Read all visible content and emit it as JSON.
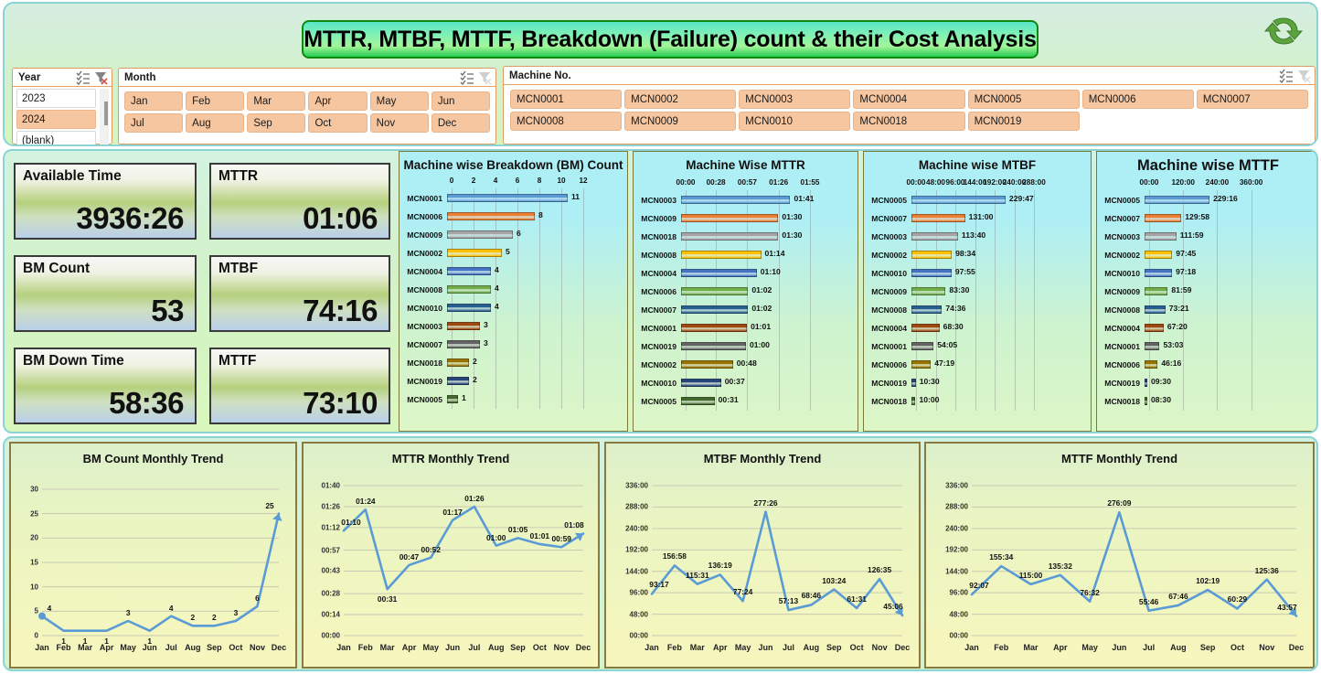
{
  "header": {
    "title": "MTTR, MTBF, MTTF, Breakdown (Failure) count & their Cost Analysis",
    "refresh_icon": "refresh-sync-icon"
  },
  "slicers": {
    "year": {
      "title": "Year",
      "multi_select_icon": "multi-select-icon",
      "clear_filter_icon": "clear-filter-icon",
      "items": [
        {
          "label": "2023",
          "selected": false
        },
        {
          "label": "2024",
          "selected": true
        },
        {
          "label": "(blank)",
          "selected": false
        }
      ]
    },
    "month": {
      "title": "Month",
      "multi_select_icon": "multi-select-icon",
      "clear_filter_icon": "clear-filter-icon",
      "items": [
        "Jan",
        "Feb",
        "Mar",
        "Apr",
        "May",
        "Jun",
        "Jul",
        "Aug",
        "Sep",
        "Oct",
        "Nov",
        "Dec"
      ]
    },
    "machine": {
      "title": "Machine No.",
      "multi_select_icon": "multi-select-icon",
      "clear_filter_icon": "clear-filter-icon",
      "items": [
        "MCN0001",
        "MCN0002",
        "MCN0003",
        "MCN0004",
        "MCN0005",
        "MCN0006",
        "MCN0007",
        "MCN0008",
        "MCN0009",
        "MCN0010",
        "MCN0018",
        "MCN0019"
      ]
    }
  },
  "kpis": [
    {
      "label": "Available Time",
      "value": "3936:26"
    },
    {
      "label": "MTTR",
      "value": "01:06"
    },
    {
      "label": "BM Count",
      "value": "53"
    },
    {
      "label": "MTBF",
      "value": "74:16"
    },
    {
      "label": "BM Down Time",
      "value": "58:36"
    },
    {
      "label": "MTTF",
      "value": "73:10"
    }
  ],
  "palette": {
    "series": [
      "#5b9bd5",
      "#ed7d31",
      "#a5a5a5",
      "#ffc000",
      "#4472c4",
      "#70ad47",
      "#255e91",
      "#9e480e",
      "#636363",
      "#997300",
      "#264478",
      "#43682b"
    ],
    "accent_green": "#27cc52",
    "panel_border": "#8ad4d4",
    "chip": "#f5c6a0"
  },
  "chart_data": [
    {
      "type": "bar",
      "id": "machine-wise-bm-count",
      "title": "Machine wise Breakdown (BM) Count",
      "orientation": "horizontal",
      "categories": [
        "MCN0001",
        "MCN0006",
        "MCN0009",
        "MCN0002",
        "MCN0004",
        "MCN0008",
        "MCN0010",
        "MCN0003",
        "MCN0007",
        "MCN0018",
        "MCN0019",
        "MCN0005"
      ],
      "values": [
        11,
        8,
        6,
        5,
        4,
        4,
        4,
        3,
        3,
        2,
        2,
        1
      ],
      "labels": [
        "11",
        "8",
        "6",
        "5",
        "4",
        "4",
        "4",
        "3",
        "3",
        "2",
        "2",
        "1"
      ],
      "ticks": [
        "0",
        "2",
        "4",
        "6",
        "8",
        "10",
        "12"
      ],
      "tick_values": [
        0,
        2,
        4,
        6,
        8,
        10,
        12
      ],
      "xlim": [
        0,
        12
      ],
      "xlabel": "",
      "ylabel": "",
      "grid": true,
      "legend": "none"
    },
    {
      "type": "bar",
      "id": "machine-wise-mttr",
      "title": "Machine Wise MTTR",
      "orientation": "horizontal",
      "categories": [
        "MCN0003",
        "MCN0009",
        "MCN0018",
        "MCN0008",
        "MCN0004",
        "MCN0006",
        "MCN0007",
        "MCN0001",
        "MCN0019",
        "MCN0002",
        "MCN0010",
        "MCN0005"
      ],
      "labels": [
        "01:41",
        "01:30",
        "01:30",
        "01:14",
        "01:10",
        "01:02",
        "01:02",
        "01:01",
        "01:00",
        "00:48",
        "00:37",
        "00:31"
      ],
      "values": [
        101,
        90,
        90,
        74,
        70,
        62,
        62,
        61,
        60,
        48,
        37,
        31
      ],
      "value_unit": "minutes",
      "ticks": [
        "00:00",
        "00:28",
        "00:57",
        "01:26",
        "01:55"
      ],
      "tick_values": [
        0,
        28,
        57,
        86,
        115
      ],
      "xlim": [
        0,
        115
      ],
      "xlabel": "",
      "ylabel": "",
      "grid": true,
      "legend": "none"
    },
    {
      "type": "bar",
      "id": "machine-wise-mtbf",
      "title": "Machine wise MTBF",
      "orientation": "horizontal",
      "categories": [
        "MCN0005",
        "MCN0007",
        "MCN0003",
        "MCN0002",
        "MCN0010",
        "MCN0009",
        "MCN0008",
        "MCN0004",
        "MCN0001",
        "MCN0006",
        "MCN0019",
        "MCN0018"
      ],
      "labels": [
        "229:47",
        "131:00",
        "113:40",
        "98:34",
        "97:55",
        "83:30",
        "74:36",
        "68:30",
        "54:05",
        "47:19",
        "10:30",
        "10:00"
      ],
      "values": [
        229.78,
        131.0,
        113.67,
        98.57,
        97.92,
        83.5,
        74.6,
        68.5,
        54.08,
        47.32,
        10.5,
        10.0
      ],
      "value_unit": "hours",
      "ticks": [
        "00:00",
        "48:00",
        "96:00",
        "144:00",
        "192:00",
        "240:00",
        "288:00"
      ],
      "tick_values": [
        0,
        48,
        96,
        144,
        192,
        240,
        288
      ],
      "xlim": [
        0,
        288
      ],
      "xlabel": "",
      "ylabel": "",
      "grid": true,
      "legend": "none"
    },
    {
      "type": "bar",
      "id": "machine-wise-mttf",
      "title": "Machine wise MTTF",
      "orientation": "horizontal",
      "categories": [
        "MCN0005",
        "MCN0007",
        "MCN0003",
        "MCN0002",
        "MCN0010",
        "MCN0009",
        "MCN0008",
        "MCN0004",
        "MCN0001",
        "MCN0006",
        "MCN0019",
        "MCN0018"
      ],
      "labels": [
        "229:16",
        "129:58",
        "111:59",
        "97:45",
        "97:18",
        "81:59",
        "73:21",
        "67:20",
        "53:03",
        "46:16",
        "09:30",
        "08:30"
      ],
      "values": [
        229.27,
        129.97,
        111.98,
        97.75,
        97.3,
        81.98,
        73.35,
        67.33,
        53.05,
        46.27,
        9.5,
        8.5
      ],
      "value_unit": "hours",
      "ticks": [
        "00:00",
        "120:00",
        "240:00",
        "360:00"
      ],
      "tick_values": [
        0,
        120,
        240,
        360
      ],
      "xlim": [
        0,
        400
      ],
      "xlabel": "",
      "ylabel": "",
      "grid": true,
      "legend": "none"
    },
    {
      "type": "line",
      "id": "bm-count-monthly-trend",
      "title": "BM Count Monthly Trend",
      "categories": [
        "Jan",
        "Feb",
        "Mar",
        "Apr",
        "May",
        "Jun",
        "Jul",
        "Aug",
        "Sep",
        "Oct",
        "Nov",
        "Dec"
      ],
      "values": [
        4,
        1,
        1,
        1,
        3,
        1,
        4,
        2,
        2,
        3,
        6,
        25
      ],
      "labels": [
        "4",
        "1",
        "1",
        "1",
        "3",
        "1",
        "4",
        "2",
        "2",
        "3",
        "6",
        "25"
      ],
      "yticks": [
        "0",
        "5",
        "10",
        "15",
        "20",
        "25",
        "30"
      ],
      "ytick_values": [
        0,
        5,
        10,
        15,
        20,
        25,
        30
      ],
      "ylim": [
        0,
        30
      ],
      "xlabel": "",
      "ylabel": "",
      "grid": true,
      "legend": "none",
      "line_color": "#5b9bd5"
    },
    {
      "type": "line",
      "id": "mttr-monthly-trend",
      "title": "MTTR Monthly Trend",
      "categories": [
        "Jan",
        "Feb",
        "Mar",
        "Apr",
        "May",
        "Jun",
        "Jul",
        "Aug",
        "Sep",
        "Oct",
        "Nov",
        "Dec"
      ],
      "labels": [
        "01:10",
        "01:24",
        "00:31",
        "00:47",
        "00:52",
        "01:17",
        "01:26",
        "01:00",
        "01:05",
        "01:01",
        "00:59",
        "01:08"
      ],
      "values": [
        70,
        84,
        31,
        47,
        52,
        77,
        86,
        60,
        65,
        61,
        59,
        68
      ],
      "value_unit": "minutes",
      "yticks": [
        "00:00",
        "00:14",
        "00:28",
        "00:43",
        "00:57",
        "01:12",
        "01:26",
        "01:40"
      ],
      "ytick_values": [
        0,
        14,
        28,
        43,
        57,
        72,
        86,
        100
      ],
      "ylim": [
        0,
        100
      ],
      "xlabel": "",
      "ylabel": "",
      "grid": true,
      "legend": "none",
      "line_color": "#5b9bd5"
    },
    {
      "type": "line",
      "id": "mtbf-monthly-trend",
      "title": "MTBF Monthly Trend",
      "categories": [
        "Jan",
        "Feb",
        "Mar",
        "Apr",
        "May",
        "Jun",
        "Jul",
        "Aug",
        "Sep",
        "Oct",
        "Nov",
        "Dec"
      ],
      "labels": [
        "93:17",
        "156:58",
        "115:31",
        "136:19",
        "77:24",
        "277:26",
        "57:13",
        "68:46",
        "103:24",
        "61:31",
        "126:35",
        "45:06"
      ],
      "values": [
        93.28,
        156.97,
        115.52,
        136.32,
        77.4,
        277.43,
        57.22,
        68.77,
        103.4,
        61.52,
        126.58,
        45.1
      ],
      "value_unit": "hours",
      "yticks": [
        "00:00",
        "48:00",
        "96:00",
        "144:00",
        "192:00",
        "240:00",
        "288:00",
        "336:00"
      ],
      "ytick_values": [
        0,
        48,
        96,
        144,
        192,
        240,
        288,
        336
      ],
      "ylim": [
        0,
        336
      ],
      "xlabel": "",
      "ylabel": "",
      "grid": true,
      "legend": "none",
      "line_color": "#5b9bd5"
    },
    {
      "type": "line",
      "id": "mttf-monthly-trend",
      "title": "MTTF Monthly Trend",
      "categories": [
        "Jan",
        "Feb",
        "Mar",
        "Apr",
        "May",
        "Jun",
        "Jul",
        "Aug",
        "Sep",
        "Oct",
        "Nov",
        "Dec"
      ],
      "labels": [
        "92:07",
        "155:34",
        "115:00",
        "135:32",
        "76:32",
        "276:09",
        "55:46",
        "67:46",
        "102:19",
        "60:29",
        "125:36",
        "43:57"
      ],
      "values": [
        92.12,
        155.57,
        115.0,
        135.53,
        76.53,
        276.15,
        55.77,
        67.77,
        102.32,
        60.48,
        125.6,
        43.95
      ],
      "value_unit": "hours",
      "yticks": [
        "00:00",
        "48:00",
        "96:00",
        "144:00",
        "192:00",
        "240:00",
        "288:00",
        "336:00"
      ],
      "ytick_values": [
        0,
        48,
        96,
        144,
        192,
        240,
        288,
        336
      ],
      "ylim": [
        0,
        336
      ],
      "xlabel": "",
      "ylabel": "",
      "grid": true,
      "legend": "none",
      "line_color": "#5b9bd5"
    }
  ]
}
